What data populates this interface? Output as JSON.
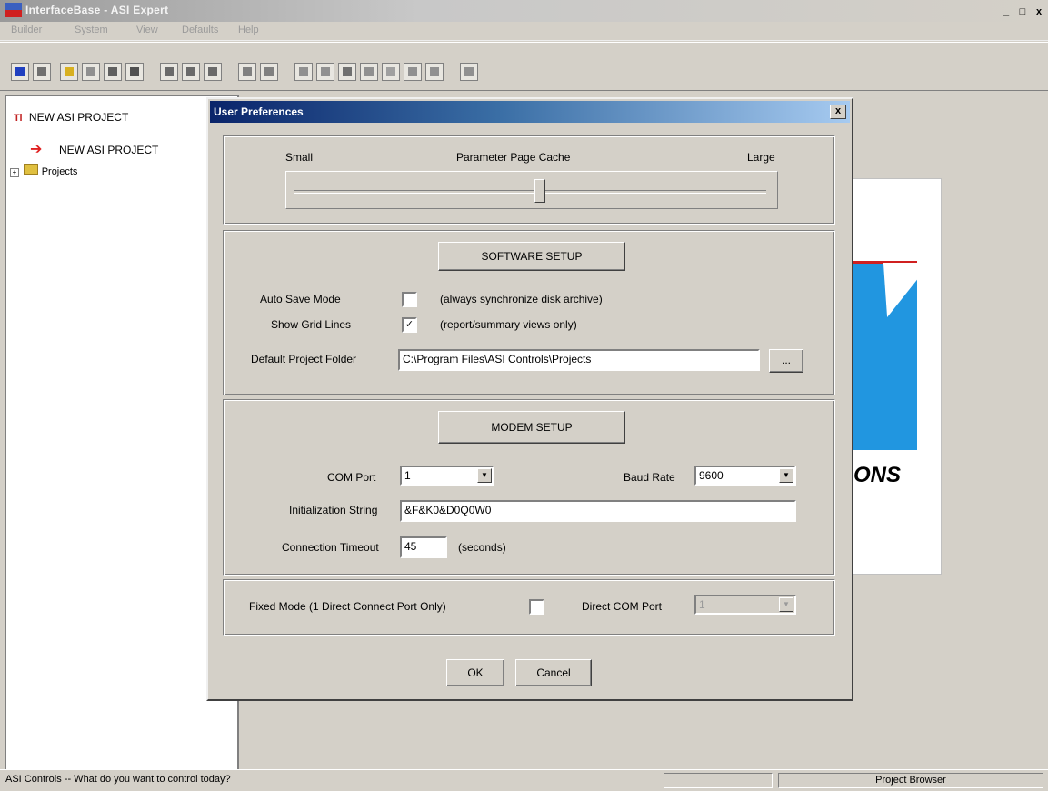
{
  "window": {
    "title": "InterfaceBase - ASI Expert",
    "min": "_",
    "max": "□",
    "close": "x"
  },
  "menu": [
    "Builder",
    "System",
    "View",
    "Defaults",
    "Help"
  ],
  "tree": {
    "root": "NEW ASI PROJECT",
    "current": "NEW ASI PROJECT",
    "projects": "Projects"
  },
  "right_pane_text": "ONS",
  "status": {
    "message": "ASI Controls -- What do you want to control today?",
    "panel": "Project Browser"
  },
  "dialog": {
    "title": "User Preferences",
    "close": "x",
    "cache": {
      "small": "Small",
      "title": "Parameter Page Cache",
      "large": "Large",
      "level": 0.52
    },
    "software": {
      "heading": "SOFTWARE SETUP",
      "auto_save_label": "Auto Save Mode",
      "auto_save_checked": false,
      "auto_save_note": "(always synchronize disk archive)",
      "grid_label": "Show Grid Lines",
      "grid_checked": true,
      "grid_note": "(report/summary views only)",
      "folder_label": "Default Project Folder",
      "folder_value": "C:\\Program Files\\ASI Controls\\Projects",
      "browse": "..."
    },
    "modem": {
      "heading": "MODEM SETUP",
      "com_port_label": "COM Port",
      "com_port_value": "1",
      "baud_label": "Baud Rate",
      "baud_value": "9600",
      "init_label": "Initialization String",
      "init_value": "&F&K0&D0Q0W0",
      "timeout_label": "Connection Timeout",
      "timeout_value": "45",
      "timeout_unit": "(seconds)"
    },
    "fixed": {
      "label": "Fixed Mode (1 Direct Connect Port Only)",
      "checked": false,
      "direct_label": "Direct COM Port",
      "direct_value": "1"
    },
    "ok": "OK",
    "cancel": "Cancel"
  }
}
